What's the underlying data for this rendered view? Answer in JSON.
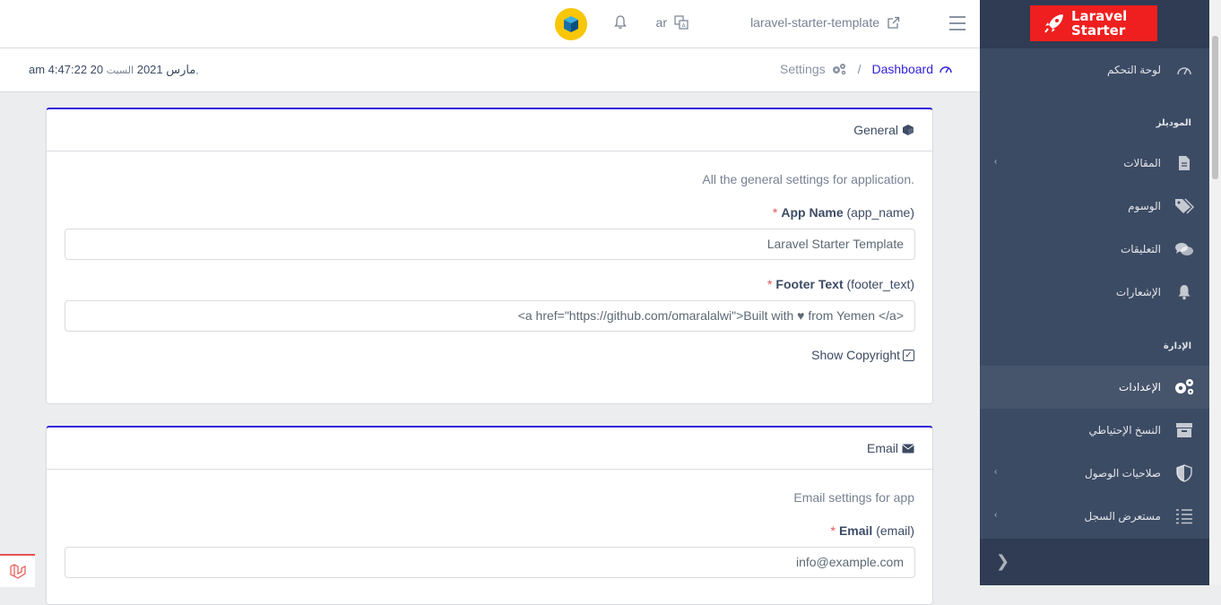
{
  "header": {
    "app_link": "laravel-starter-template",
    "lang": "ar"
  },
  "breadcrumb": {
    "dashboard": "Dashboard",
    "separator": "/",
    "settings": "Settings"
  },
  "datetime": {
    "day": "السبت,",
    "date": "20 مارس 2021",
    "time": "am 4:47:22"
  },
  "sidebar": {
    "brand_line1": "Laravel",
    "brand_line2": "Starter",
    "dashboard": "لوحة التحكم",
    "section_modules": "الموديلز",
    "posts": "المقالات",
    "tags": "الوسوم",
    "comments": "التعليقات",
    "notifications": "الإشعارات",
    "section_admin": "الإدارة",
    "settings": "الإعدادات",
    "backups": "النسخ الإحتياطي",
    "access": "صلاحيات الوصول",
    "logs": "مستعرض السجل"
  },
  "general_card": {
    "title": "General",
    "description": "All the general settings for application.",
    "app_name_label": "App Name",
    "app_name_key": "(app_name)",
    "app_name_value": "Laravel Starter Template",
    "footer_label": "Footer Text",
    "footer_key": "(footer_text)",
    "footer_value": "<a href=\"https://github.com/omaralalwi\">Built with ♥ from Yemen </a>",
    "show_copyright": "Show Copyright",
    "required_mark": "*"
  },
  "email_card": {
    "title": "Email",
    "description": "Email settings for app",
    "email_label": "Email",
    "email_key": "(email)",
    "email_value": "info@example.com",
    "required_mark": "*"
  },
  "colors": {
    "sidebar": "#3c4b64",
    "primary": "#321fdb",
    "brand_red": "#ef1f1f",
    "avatar_yellow": "#f9c606"
  }
}
